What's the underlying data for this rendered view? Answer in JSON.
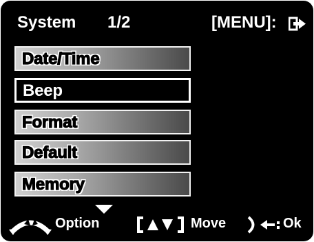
{
  "header": {
    "title": "System",
    "page": "1/2",
    "menu_hint": "[MENU]:"
  },
  "menu": {
    "items": [
      {
        "label": "Date/Time",
        "selected": false
      },
      {
        "label": "Beep",
        "selected": true
      },
      {
        "label": "Format",
        "selected": false
      },
      {
        "label": "Default",
        "selected": false
      },
      {
        "label": "Memory",
        "selected": false
      }
    ]
  },
  "footer": {
    "option_label": "Option",
    "move_label": "Move",
    "ok_label": "Ok"
  },
  "icons": {
    "exit": "exit-arrow-icon",
    "more": "down-arrow-icon",
    "wheel": "mode-dial-icon",
    "nav": "up-down-bracket-icon",
    "shutter": "shutter-press-icon"
  },
  "colors": {
    "screen_bg": "#000000",
    "text": "#ffffff",
    "item_gradient_light": "#cfcfcf",
    "item_gradient_dark": "#4a4a4a"
  }
}
